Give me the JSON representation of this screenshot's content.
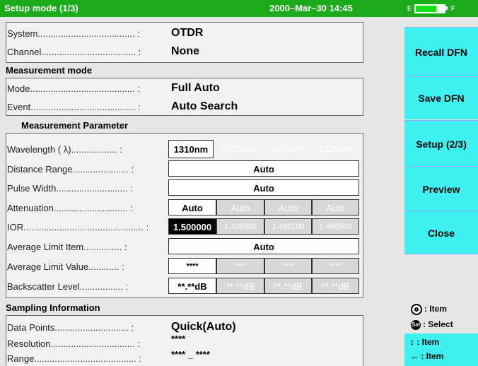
{
  "header": {
    "title": "Setup mode (1/3)",
    "datetime": "2000–Mar–30 14:45",
    "battery_left": "E",
    "battery_right": "F",
    "battery_level": 0.72
  },
  "system": {
    "label": "System",
    "value": "OTDR"
  },
  "channel": {
    "label": "Channel",
    "value": "None"
  },
  "measurement_mode": {
    "title": "Measurement mode",
    "mode_label": "Mode",
    "mode_value": "Full Auto",
    "event_label": "Event",
    "event_value": "Auto Search"
  },
  "measurement_parameter": {
    "title": "Measurement Parameter",
    "wavelength_label": "Wavelength ( λ)",
    "wavelengths": [
      "1310nm",
      "1450nm",
      "1550nm",
      "1625nm"
    ],
    "distance_label": "Distance Range",
    "distance_value": "Auto",
    "pulse_label": "Pulse Width",
    "pulse_value": "Auto",
    "attenuation_label": "Attenuation",
    "attenuation": [
      "Auto",
      "Auto",
      "Auto",
      "Auto"
    ],
    "ior_label": "IOR",
    "ior": [
      "1.500000",
      "1.465600",
      "1.466100",
      "1.466500"
    ],
    "avg_item_label": "Average Limit Item",
    "avg_item_value": "Auto",
    "avg_value_label": "Average Limit Value",
    "avg_values": [
      "****",
      "****",
      "****",
      "****"
    ],
    "backscatter_label": "Backscatter Level",
    "backscatter": [
      "**.**dB",
      "**.**dB",
      "**.**dB",
      "**.**dB"
    ]
  },
  "sampling": {
    "title": "Sampling Information",
    "points_label": "Data Points",
    "points_value": "Quick(Auto)",
    "resolution_label": "Resolution",
    "resolution_value": "****",
    "range_label": "Range",
    "range_value": "**** _ ****"
  },
  "sidebar": {
    "recall": "Recall DFN",
    "save": "Save DFN",
    "setup": "Setup (2/3)",
    "preview": "Preview",
    "close": "Close"
  },
  "legend": {
    "item1": ": Item",
    "select": ": Select",
    "item2": ": Item",
    "item3": ": Item"
  },
  "colors": {
    "title_green": "#1aaa1a",
    "side_cyan": "#3ff0f0"
  }
}
